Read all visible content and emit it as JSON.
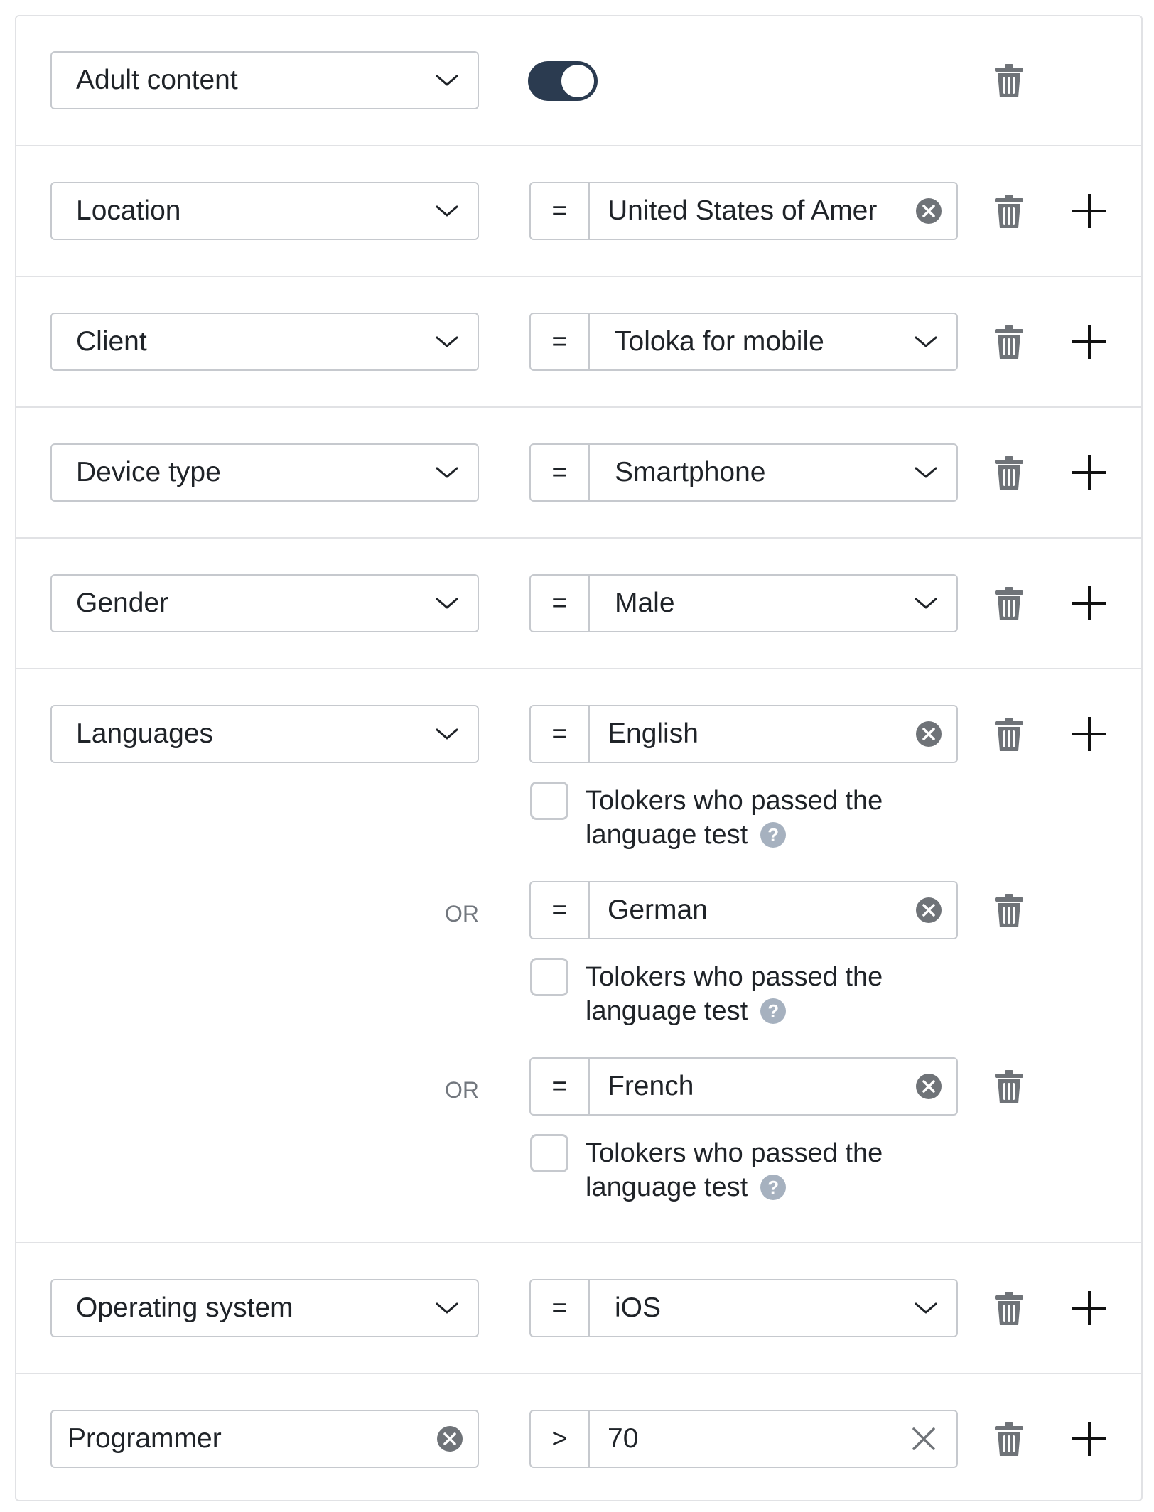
{
  "rows": {
    "adult": {
      "attribute": "Adult content",
      "toggle_on": true
    },
    "location": {
      "attribute": "Location",
      "operator": "=",
      "value": "United States of Amer"
    },
    "client": {
      "attribute": "Client",
      "operator": "=",
      "value": "Toloka for mobile"
    },
    "device": {
      "attribute": "Device type",
      "operator": "=",
      "value": "Smartphone"
    },
    "gender": {
      "attribute": "Gender",
      "operator": "=",
      "value": "Male"
    },
    "languages": {
      "attribute": "Languages",
      "items": [
        {
          "operator": "=",
          "value": "English",
          "checkbox_label": "Tolokers who passed the language test",
          "checked": false
        },
        {
          "connector": "OR",
          "operator": "=",
          "value": "German",
          "checkbox_label": "Tolokers who passed the language test",
          "checked": false
        },
        {
          "connector": "OR",
          "operator": "=",
          "value": "French",
          "checkbox_label": "Tolokers who passed the language test",
          "checked": false
        }
      ]
    },
    "os": {
      "attribute": "Operating system",
      "operator": "=",
      "value": "iOS"
    },
    "programmer": {
      "attribute": "Programmer",
      "operator": ">",
      "value": "70"
    }
  },
  "help_glyph": "?",
  "colors": {
    "toggle_on": "#2b3b50",
    "border": "#c6c9ce",
    "icon": "#6f7378",
    "help": "#a6b1bf"
  }
}
